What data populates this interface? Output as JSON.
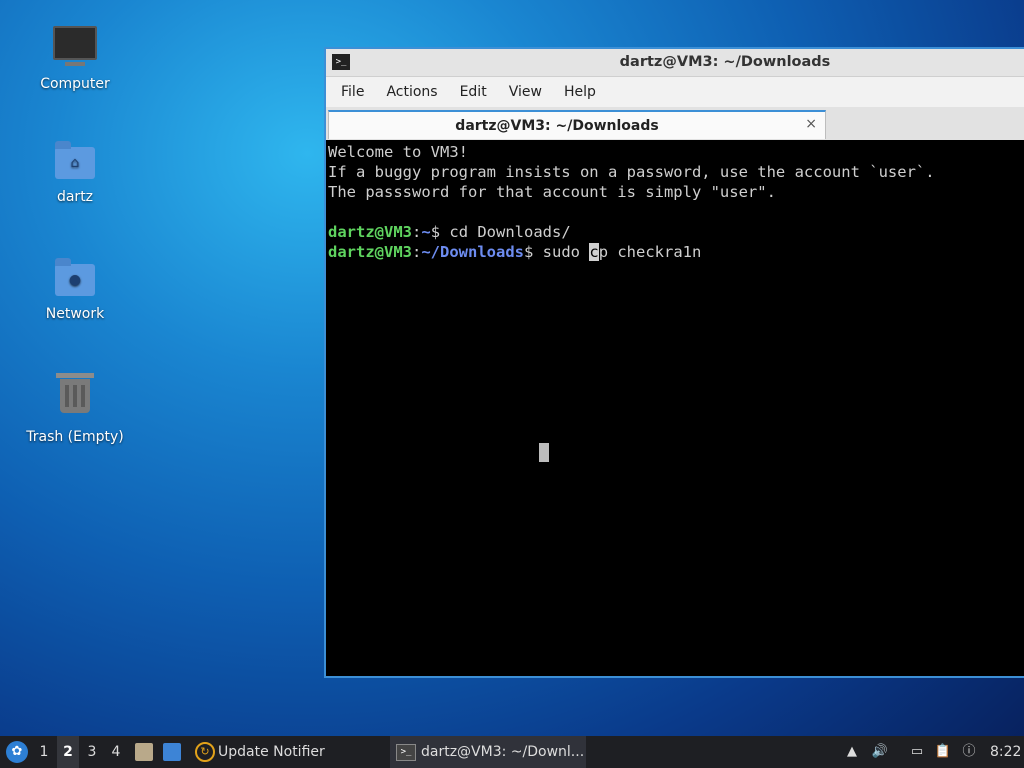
{
  "desktop": {
    "icons": [
      {
        "label": "Computer",
        "icon": "computer-icon"
      },
      {
        "label": "dartz",
        "icon": "home-folder-icon"
      },
      {
        "label": "Network",
        "icon": "network-folder-icon"
      },
      {
        "label": "Trash (Empty)",
        "icon": "trash-icon"
      }
    ]
  },
  "window": {
    "title": "dartz@VM3: ~/Downloads",
    "menu": [
      "File",
      "Actions",
      "Edit",
      "View",
      "Help"
    ],
    "tab_title": "dartz@VM3: ~/Downloads",
    "tab_close": "×"
  },
  "terminal": {
    "welcome_lines": [
      "Welcome to VM3!",
      "If a buggy program insists on a password, use the account `user`.",
      "The passsword for that account is simply \"user\"."
    ],
    "prompt_user": "dartz@VM3",
    "cmd1_path": "~",
    "cmd1": "cd Downloads/",
    "cmd2_path": "~/Downloads",
    "cmd2_pre": "sudo ",
    "cmd2_cursor_char": "c",
    "cmd2_post": "p checkra1n"
  },
  "taskbar": {
    "workspaces": [
      "1",
      "2",
      "3",
      "4"
    ],
    "active_workspace": "2",
    "notifier_label": "Update Notifier",
    "task_label": "dartz@VM3: ~/Downl...",
    "clock": "8:22"
  },
  "colors": {
    "prompt_green": "#5fd35f",
    "prompt_blue": "#6d8cf0",
    "accent": "#3c8fd6",
    "taskbar_bg": "#1e1f23"
  }
}
